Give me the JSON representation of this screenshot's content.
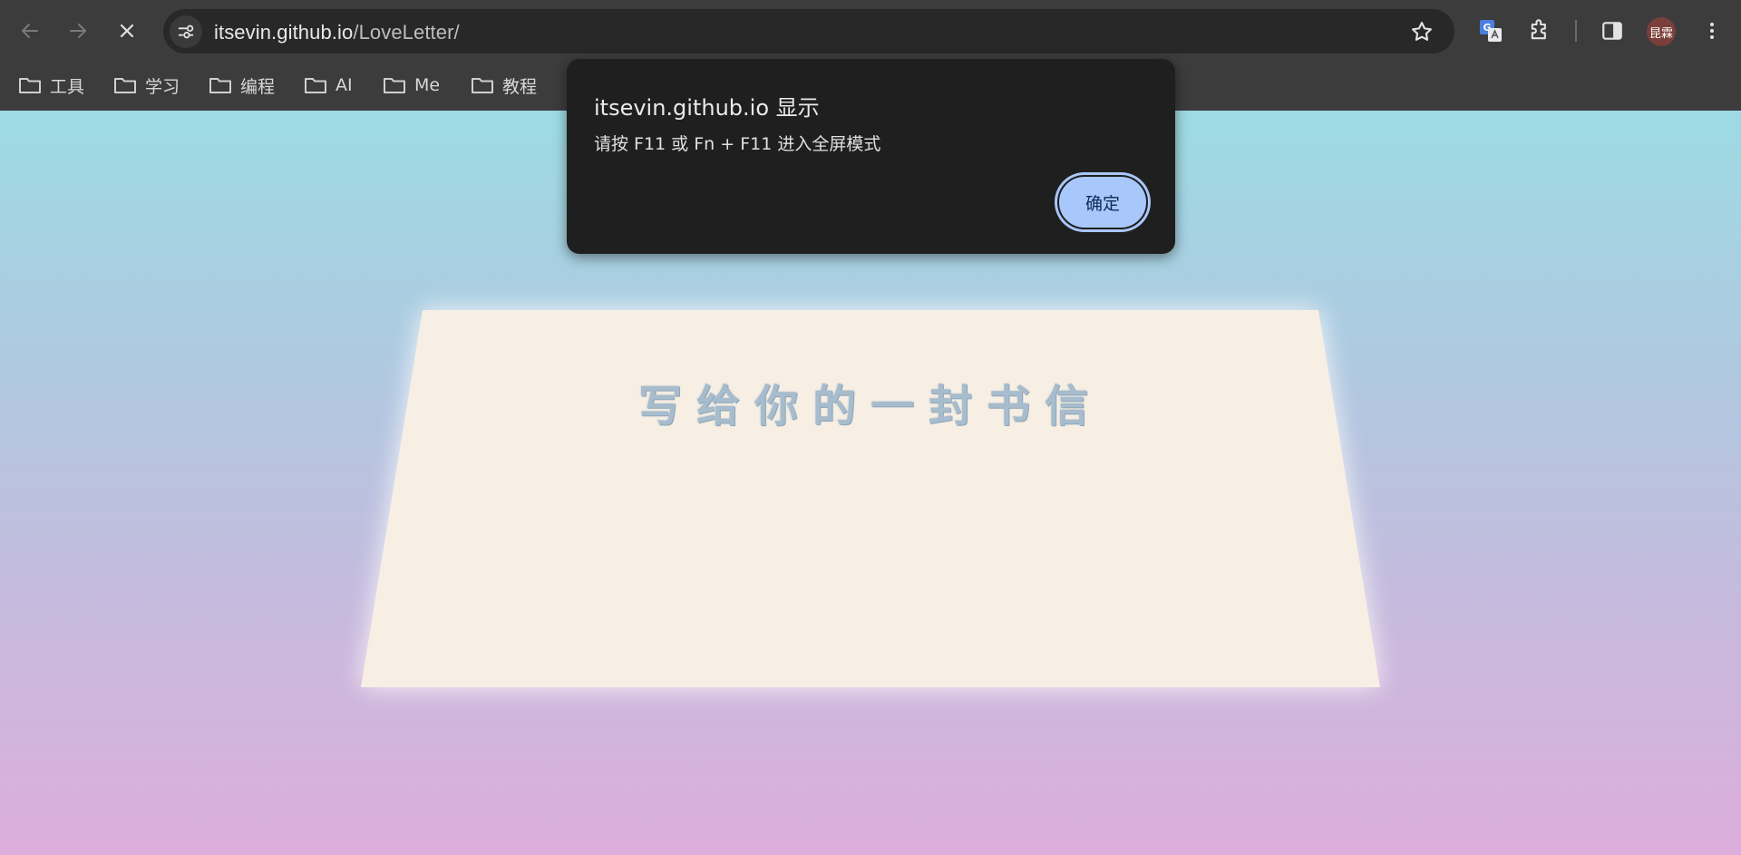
{
  "browser": {
    "url_host": "itsevin.github.io",
    "url_path": "/LoveLetter/",
    "profile_avatar_text": "昆霖"
  },
  "bookmarks": [
    {
      "label": "工具"
    },
    {
      "label": "学习"
    },
    {
      "label": "编程"
    },
    {
      "label": "AI"
    },
    {
      "label": "Me"
    },
    {
      "label": "教程"
    }
  ],
  "dialog": {
    "title": "itsevin.github.io 显示",
    "message": "请按 F11 或 Fn + F11 进入全屏模式",
    "ok_label": "确定"
  },
  "page": {
    "envelope_title": "写给你的一封书信"
  },
  "icons": [
    "back-arrow-icon",
    "forward-arrow-icon",
    "close-icon",
    "site-settings-icon",
    "star-icon",
    "translate-icon",
    "extensions-icon",
    "side-panel-icon",
    "more-menu-icon",
    "folder-icon"
  ],
  "colors": {
    "toolbar": "#3c3c3c",
    "omnibox": "#282828",
    "dialog_bg": "#1f1f1f",
    "button_accent": "#a8c7fa",
    "envelope": "#f7efe4",
    "gradient_top": "#9ddbe3",
    "gradient_bottom": "#dcaedb"
  }
}
